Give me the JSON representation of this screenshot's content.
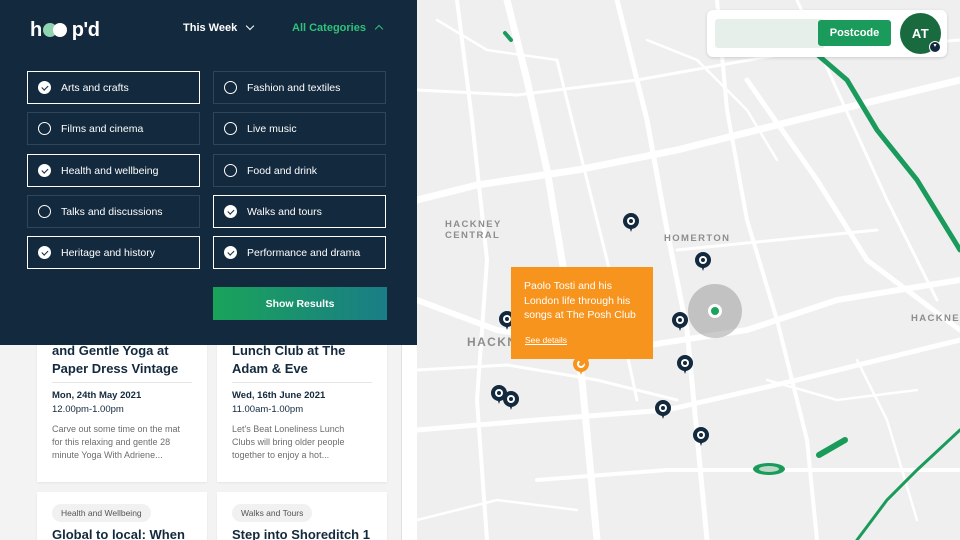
{
  "brand": {
    "logo_prefix": "h",
    "logo_suffix": "p'd"
  },
  "header": {
    "week_filter": "This Week",
    "category_filter": "All Categories"
  },
  "categories": [
    {
      "label": "Arts and crafts",
      "checked": true
    },
    {
      "label": "Fashion and textiles",
      "checked": false
    },
    {
      "label": "Films and cinema",
      "checked": false
    },
    {
      "label": "Live music",
      "checked": false
    },
    {
      "label": "Health and wellbeing",
      "checked": true
    },
    {
      "label": "Food and drink",
      "checked": false
    },
    {
      "label": "Talks and discussions",
      "checked": false
    },
    {
      "label": "Walks and tours",
      "checked": true
    },
    {
      "label": "Heritage and history",
      "checked": true
    },
    {
      "label": "Performance and drama",
      "checked": true
    }
  ],
  "show_results_label": "Show Results",
  "cards": [
    {
      "title_line1": "and Gentle Yoga at",
      "title_line2": "Paper Dress Vintage",
      "date": "Mon, 24th May 2021",
      "time": "12.00pm-1.00pm",
      "desc_line1": "Carve out some time on the mat",
      "desc_line2": "for this relaxing and gentle 28",
      "desc_line3": "minute Yoga With Adriene..."
    },
    {
      "title_line1": "Lunch Club at The",
      "title_line2": "Adam & Eve",
      "date": "Wed, 16th June 2021",
      "time": "11.00am-1.00pm",
      "desc_line1": "Let's Beat Loneliness Lunch",
      "desc_line2": "Clubs will bring older people",
      "desc_line3": "together to enjoy a hot..."
    },
    {
      "tag": "Health and Wellbeing",
      "title_line1": "Global to local: When"
    },
    {
      "tag": "Walks and Tours",
      "title_line1": "Step into Shoreditch 1"
    }
  ],
  "search": {
    "placeholder": "",
    "button_label": "Postcode"
  },
  "user": {
    "initials": "AT"
  },
  "map": {
    "labels": {
      "hackney_central_1": "HACKNEY",
      "hackney_central_2": "CENTRAL",
      "homerton": "HOMERTON",
      "hackney_right": "HACKNEY",
      "hackney_left": "HACKN"
    },
    "popup": {
      "title_line1": "Paolo Tosti and his",
      "title_line2": "London life through his",
      "title_line3": "songs at The Posh Club",
      "link": "See details"
    }
  },
  "colors": {
    "panel": "#13293d",
    "accent_green": "#1aa35a",
    "popup_orange": "#f7941d"
  }
}
